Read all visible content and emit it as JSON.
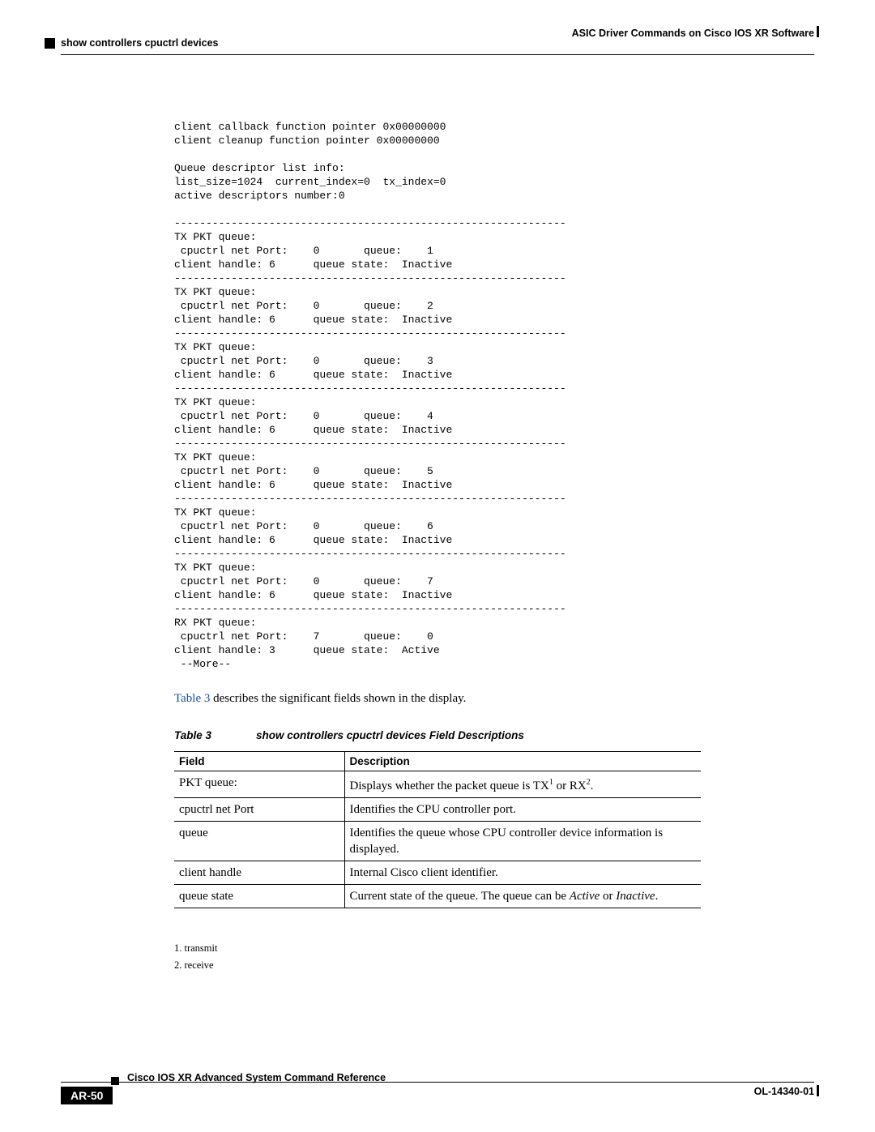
{
  "header": {
    "left": "show controllers cpuctrl devices",
    "right": "ASIC Driver Commands on Cisco IOS XR Software"
  },
  "cli": {
    "pre": "client callback function pointer 0x00000000\nclient cleanup function pointer 0x00000000\n\nQueue descriptor list info:\nlist_size=1024  current_index=0  tx_index=0\nactive descriptors number:0\n",
    "sep": "--------------------------------------------------------------",
    "queues": [
      {
        "type": "TX",
        "port": "0",
        "queue": "1",
        "handle": "6",
        "state": "Inactive"
      },
      {
        "type": "TX",
        "port": "0",
        "queue": "2",
        "handle": "6",
        "state": "Inactive"
      },
      {
        "type": "TX",
        "port": "0",
        "queue": "3",
        "handle": "6",
        "state": "Inactive"
      },
      {
        "type": "TX",
        "port": "0",
        "queue": "4",
        "handle": "6",
        "state": "Inactive"
      },
      {
        "type": "TX",
        "port": "0",
        "queue": "5",
        "handle": "6",
        "state": "Inactive"
      },
      {
        "type": "TX",
        "port": "0",
        "queue": "6",
        "handle": "6",
        "state": "Inactive"
      },
      {
        "type": "TX",
        "port": "0",
        "queue": "7",
        "handle": "6",
        "state": "Inactive"
      },
      {
        "type": "RX",
        "port": "7",
        "queue": "0",
        "handle": "3",
        "state": "Active"
      }
    ],
    "more": " --More--"
  },
  "para": {
    "link": "Table 3",
    "rest": " describes the significant fields shown in the display."
  },
  "table": {
    "caption_num": "Table 3",
    "caption_title": "show controllers cpuctrl devices Field Descriptions",
    "head_field": "Field",
    "head_desc": "Description",
    "rows": [
      {
        "f": "PKT queue:",
        "d_pre": "Displays whether the packet queue is TX",
        "d_sup1": "1",
        "d_mid": " or RX",
        "d_sup2": "2",
        "d_post": "."
      },
      {
        "f": "cpuctrl net Port",
        "d": "Identifies the CPU controller port."
      },
      {
        "f": "queue",
        "d": "Identifies the queue whose CPU controller device information is displayed."
      },
      {
        "f": "client handle",
        "d": "Internal Cisco client identifier."
      },
      {
        "f": "queue state",
        "d_pre": "Current state of the queue. The queue can be ",
        "d_i1": "Active",
        "d_mid": " or ",
        "d_i2": "Inactive",
        "d_post": "."
      }
    ]
  },
  "footnotes": {
    "n1": "1. transmit",
    "n2": "2. receive"
  },
  "footer": {
    "title": "Cisco IOS XR Advanced System Command Reference",
    "page": "AR-50",
    "doc": "OL-14340-01"
  }
}
